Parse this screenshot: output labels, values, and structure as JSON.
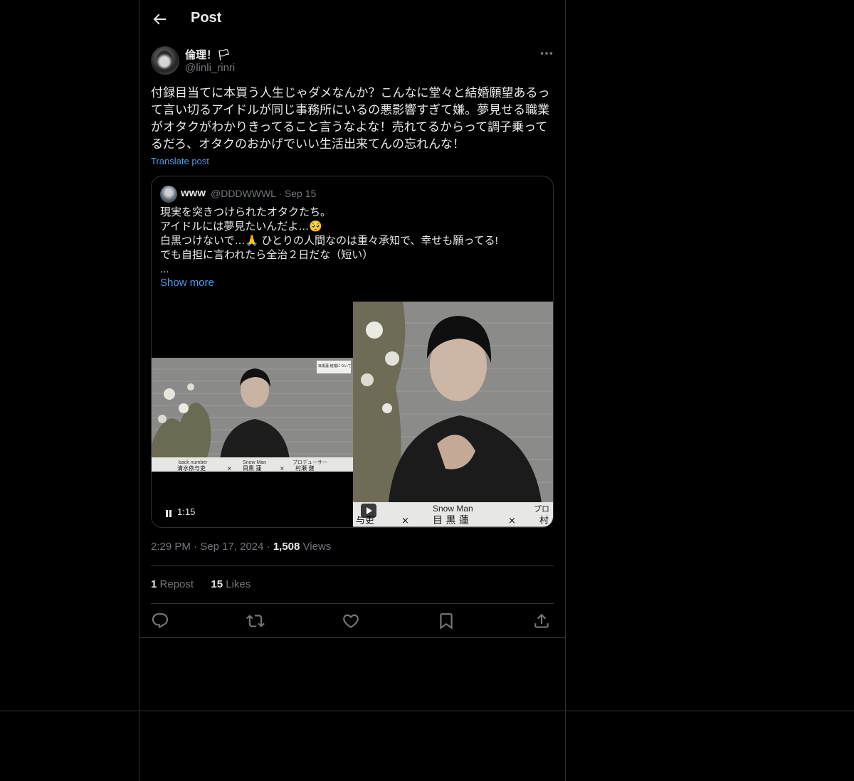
{
  "header": {
    "title": "Post"
  },
  "post": {
    "author_name": "倫理！🏳",
    "author_handle": "@linli_rinri",
    "text": "付録目当てに本買う人生じゃダメなんか？こんなに堂々と結婚願望あるって言い切るアイドルが同じ事務所にいるの悪影響すぎて嫌。夢見せる職業がオタクがわかりきってること言うなよな！売れてるからって調子乗ってるだろ、オタクのおかげでいい生活出来てんの忘れんな！",
    "translate_label": "Translate post",
    "time": "2:29 PM",
    "date": "Sep 17, 2024",
    "views_count": "1,508",
    "views_label": "Views",
    "reposts_count": "1",
    "reposts_label": "Repost",
    "likes_count": "15",
    "likes_label": "Likes"
  },
  "quote": {
    "name": "www",
    "handle": "@DDDWWWL",
    "date": "Sep 15",
    "lines": [
      "現実を突きつけられたオタクたち。",
      "アイドルには夢見たいんだよ…🥺",
      "白黒つけないで…🙏 ひとりの人間なのは重々承知で、幸せも願ってる!",
      "でも自担に言われたら全治２日だな（短い）",
      "..."
    ],
    "show_more": "Show more",
    "video_duration": "1:15"
  },
  "video_captions": {
    "left_label_1": "back number",
    "left_label_2": "Snow Man",
    "left_label_3": "プロデューサー",
    "left_name_1": "清水依与吏",
    "left_name_2": "目黒 蓮",
    "left_name_3": "村瀬 健",
    "left_sign": "目黒蓮 結婚について",
    "right_label": "Snow Man",
    "right_name": "目 黒 蓮",
    "right_cut_left": "与吏",
    "right_cut_right": "プロ",
    "right_cut_right2": "村",
    "cross": "×"
  },
  "icons": {
    "back": "arrow-left-icon",
    "more": "more-horizontal-icon",
    "reply": "reply-icon",
    "repost": "repost-icon",
    "like": "heart-icon",
    "bookmark": "bookmark-icon",
    "share": "share-icon"
  },
  "colors": {
    "accent": "#1d9bf0",
    "link": "#4d9aeb",
    "muted": "#71767b",
    "border": "#2f3336",
    "text": "#e7e9ea"
  }
}
